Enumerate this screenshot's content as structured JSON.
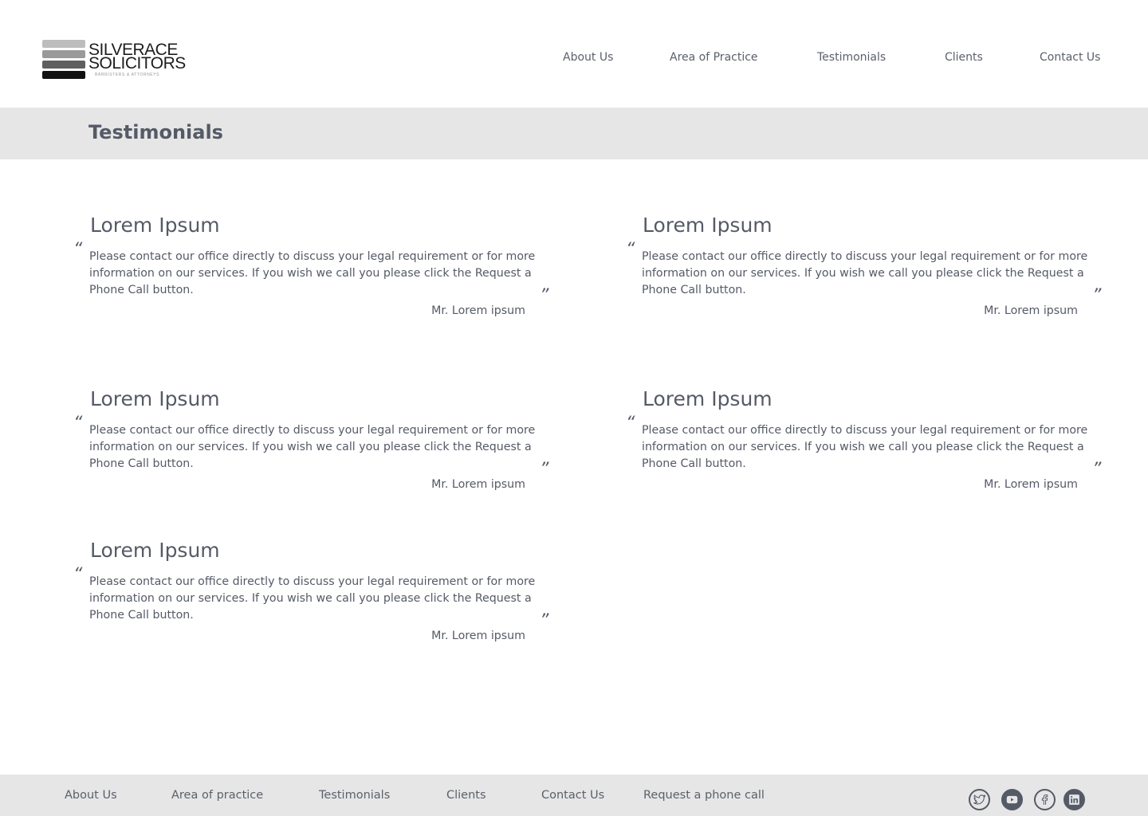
{
  "logo": {
    "line1": "SILVERACE",
    "line2": "SOLICITORS",
    "tagline": "BARRISTERS & ATTORNEYS"
  },
  "nav": {
    "about": "About Us",
    "practice": "Area of Practice",
    "testimonials": "Testimonials",
    "clients": "Clients",
    "contact": "Contact Us"
  },
  "page": {
    "title": "Testimonials"
  },
  "quote_marks": {
    "open": "“",
    "close": "”"
  },
  "testimonials": [
    {
      "heading": "Lorem Ipsum",
      "body": "Please contact our office directly to discuss your legal requirement  or for more information on our services. If you wish we call you please click the Request a Phone Call button.",
      "author": "Mr. Lorem ipsum"
    },
    {
      "heading": "Lorem Ipsum",
      "body": "Please contact our office directly to discuss your legal requirement  or for more information on our services. If you wish we call you please click the Request a Phone Call button.",
      "author": "Mr. Lorem ipsum"
    },
    {
      "heading": "Lorem Ipsum",
      "body": "Please contact our office directly to discuss your legal requirement  or for more information on our services. If you wish we call you please click the Request a Phone Call button.",
      "author": "Mr. Lorem ipsum"
    },
    {
      "heading": "Lorem Ipsum",
      "body": "Please contact our office directly to discuss your legal requirement  or for more information on our services. If you wish we call you please click the Request a Phone Call button.",
      "author": "Mr. Lorem ipsum"
    },
    {
      "heading": "Lorem Ipsum",
      "body": "Please contact our office directly to discuss your legal requirement  or for more information on our services. If you wish we call you please click the Request a Phone Call button.",
      "author": "Mr. Lorem ipsum"
    }
  ],
  "footer": {
    "about": "About Us",
    "practice": "Area of practice",
    "testimonials": "Testimonials",
    "clients": "Clients",
    "contact": "Contact Us",
    "request_call": "Request a phone call",
    "social": [
      "twitter-icon",
      "youtube-icon",
      "facebook-icon",
      "linkedin-icon"
    ]
  },
  "colors": {
    "text": "#555a66",
    "band": "#e6e6e6"
  }
}
